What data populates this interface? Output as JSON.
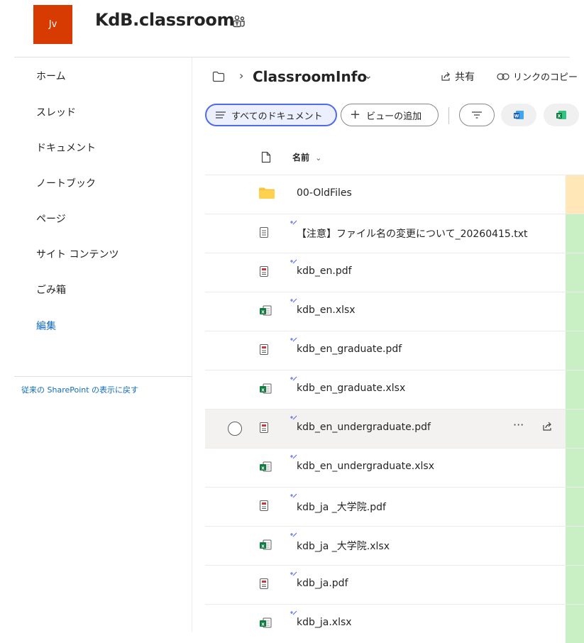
{
  "header": {
    "avatar_initials": "Jv",
    "site_title": "KdB.classroom",
    "teams_icon": "teams-icon"
  },
  "nav": {
    "items": [
      {
        "label": "ホーム"
      },
      {
        "label": "スレッド"
      },
      {
        "label": "ドキュメント"
      },
      {
        "label": "ノートブック"
      },
      {
        "label": "ページ"
      },
      {
        "label": "サイト コンテンツ"
      },
      {
        "label": "ごみ箱"
      },
      {
        "label": "編集"
      }
    ],
    "classic_link": "従来の SharePoint の表示に戻す"
  },
  "breadcrumb": {
    "folder": "ClassroomInfo",
    "share_label": "共有",
    "copy_link_label": "リンクのコピー"
  },
  "toolbar": {
    "all_documents": "すべてのドキュメント",
    "add_view": "ビューの追加"
  },
  "list": {
    "name_header": "名前",
    "files": [
      {
        "name": "00-OldFiles",
        "type": "folder",
        "new": false
      },
      {
        "name": "【注意】ファイル名の変更について_20260415.txt",
        "type": "txt",
        "new": true
      },
      {
        "name": "kdb_en.pdf",
        "type": "pdf",
        "new": true
      },
      {
        "name": "kdb_en.xlsx",
        "type": "xlsx",
        "new": true
      },
      {
        "name": "kdb_en_graduate.pdf",
        "type": "pdf",
        "new": true
      },
      {
        "name": "kdb_en_graduate.xlsx",
        "type": "xlsx",
        "new": true
      },
      {
        "name": "kdb_en_undergraduate.pdf",
        "type": "pdf",
        "new": true,
        "hovered": true
      },
      {
        "name": "kdb_en_undergraduate.xlsx",
        "type": "xlsx",
        "new": true
      },
      {
        "name": "kdb_ja _大学院.pdf",
        "type": "pdf",
        "new": true
      },
      {
        "name": "kdb_ja _大学院.xlsx",
        "type": "xlsx",
        "new": true
      },
      {
        "name": "kdb_ja.pdf",
        "type": "pdf",
        "new": true
      },
      {
        "name": "kdb_ja.xlsx",
        "type": "xlsx",
        "new": true
      }
    ]
  },
  "colors": {
    "accent": "#4f6bed",
    "link": "#0f6cbd",
    "logo_bg": "#d83b01",
    "folder": "#f5c542",
    "excel": "#107c41",
    "word": "#185abd",
    "pdf": "#d13438",
    "strip_green": "#c9efc4",
    "strip_orange": "#ffe7b8"
  }
}
